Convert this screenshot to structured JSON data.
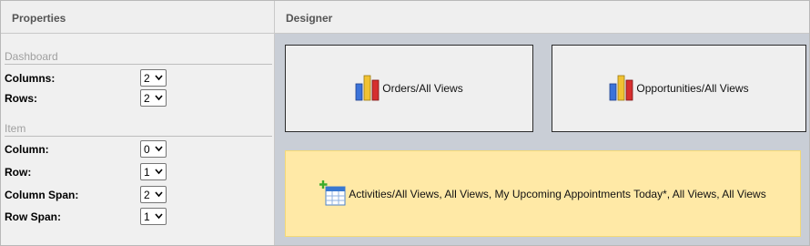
{
  "panels": {
    "properties_title": "Properties",
    "designer_title": "Designer"
  },
  "dashboard_group": {
    "title": "Dashboard",
    "columns": {
      "label": "Columns:",
      "value": "2"
    },
    "rows": {
      "label": "Rows:",
      "value": "2"
    }
  },
  "item_group": {
    "title": "Item",
    "column": {
      "label": "Column:",
      "value": "0"
    },
    "row": {
      "label": "Row:",
      "value": "1"
    },
    "column_span": {
      "label": "Column Span:",
      "value": "2"
    },
    "row_span": {
      "label": "Row Span:",
      "value": "1"
    }
  },
  "tiles": {
    "orders": {
      "label": "Orders/All Views",
      "icon": "bar-chart-icon"
    },
    "opportunities": {
      "label": "Opportunities/All Views",
      "icon": "bar-chart-icon"
    },
    "activities": {
      "label": "Activities/All Views, All Views, My Upcoming Appointments Today*, All Views, All Views",
      "icon": "add-table-icon"
    }
  },
  "colors": {
    "designer_background": "#c9ced6",
    "selected_tile": "#ffe9a6",
    "tile_background": "#efefef"
  }
}
